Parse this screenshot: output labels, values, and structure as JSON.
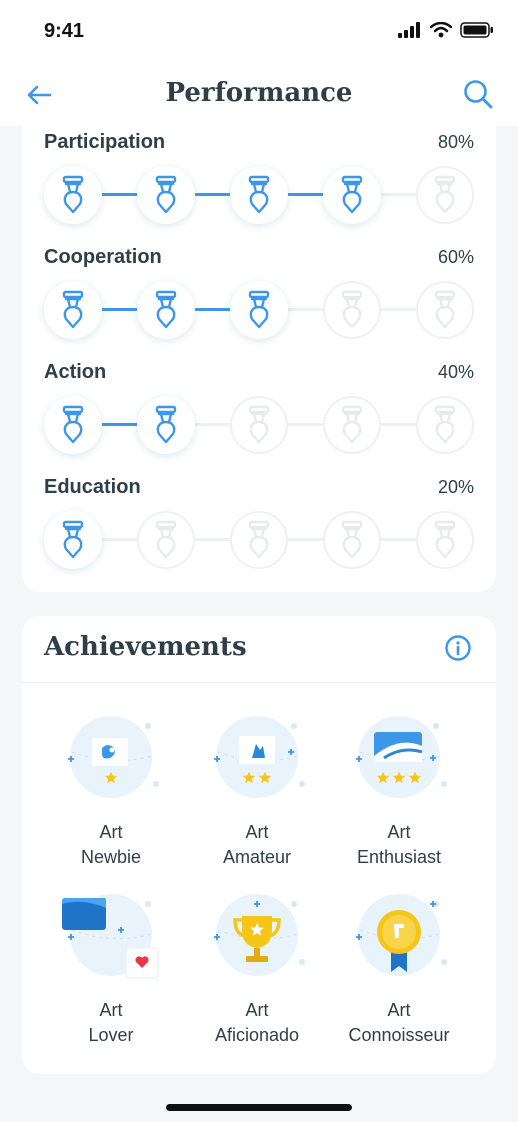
{
  "status_bar": {
    "time": "9:41"
  },
  "header": {
    "title": "Performance"
  },
  "progress": [
    {
      "name": "Participation",
      "percent_label": "80%",
      "filled": 4,
      "total": 5
    },
    {
      "name": "Cooperation",
      "percent_label": "60%",
      "filled": 3,
      "total": 5
    },
    {
      "name": "Action",
      "percent_label": "40%",
      "filled": 2,
      "total": 5
    },
    {
      "name": "Education",
      "percent_label": "20%",
      "filled": 1,
      "total": 5
    }
  ],
  "achievements": {
    "title": "Achievements",
    "badges": [
      {
        "line1": "Art",
        "line2": "Newbie",
        "stars": 1,
        "unlocked": false
      },
      {
        "line1": "Art",
        "line2": "Amateur",
        "stars": 2,
        "unlocked": false
      },
      {
        "line1": "Art",
        "line2": "Enthusiast",
        "stars": 3,
        "unlocked": false
      },
      {
        "line1": "Art",
        "line2": "Lover",
        "stars": 0,
        "unlocked": true
      },
      {
        "line1": "Art",
        "line2": "Aficionado",
        "stars": 0,
        "unlocked": true
      },
      {
        "line1": "Art",
        "line2": "Connoisseur",
        "stars": 0,
        "unlocked": true
      }
    ]
  },
  "colors": {
    "accent": "#3d97e8",
    "text": "#2f3f4a",
    "inactive": "#e8ebee",
    "star": "#f5c518",
    "heart": "#e5394a"
  },
  "icons": [
    "back-arrow-icon",
    "search-icon",
    "info-icon",
    "medal-icon",
    "star-icon",
    "trophy-icon",
    "heart-icon",
    "award-medal-icon"
  ]
}
